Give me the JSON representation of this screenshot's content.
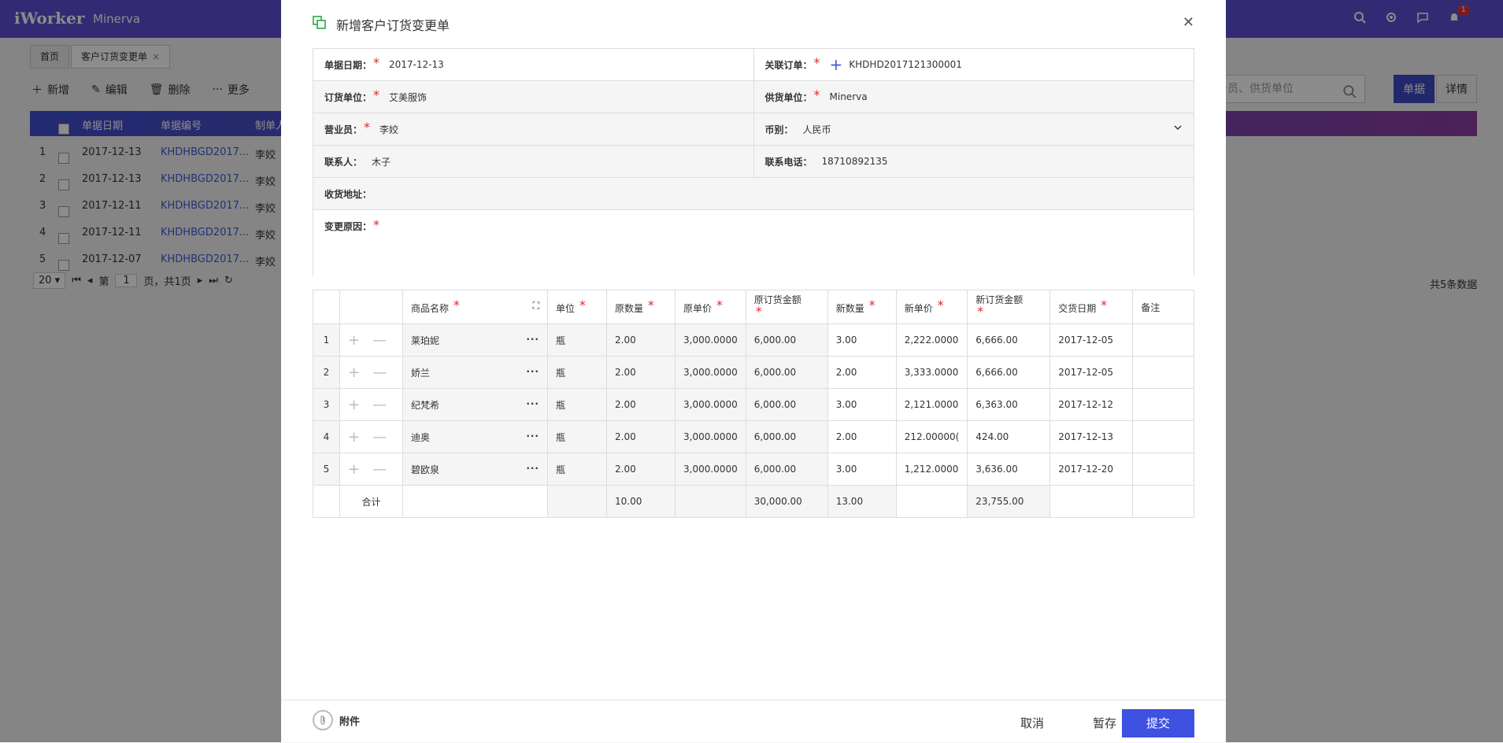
{
  "header": {
    "logo": "iWorker",
    "company": "Minerva",
    "notification_count": "1"
  },
  "tabs": [
    {
      "label": "首页"
    },
    {
      "label": "客户订货变更单"
    }
  ],
  "toolbar": {
    "add": "新增",
    "edit": "编辑",
    "delete": "删除",
    "more": "更多",
    "search_placeholder": "务员、供货单位",
    "view_doc": "单据",
    "view_detail": "详情"
  },
  "grid": {
    "columns": [
      "单据日期",
      "单据编号",
      "制单人"
    ],
    "rows": [
      {
        "idx": "1",
        "date": "2017-12-13",
        "code": "KHDHBGD2017...",
        "maker": "李姣"
      },
      {
        "idx": "2",
        "date": "2017-12-13",
        "code": "KHDHBGD2017...",
        "maker": "李姣"
      },
      {
        "idx": "3",
        "date": "2017-12-11",
        "code": "KHDHBGD2017...",
        "maker": "李姣"
      },
      {
        "idx": "4",
        "date": "2017-12-11",
        "code": "KHDHBGD2017...",
        "maker": "李姣"
      },
      {
        "idx": "5",
        "date": "2017-12-07",
        "code": "KHDHBGD2017...",
        "maker": "李姣"
      }
    ],
    "page_size": "20",
    "page_prefix": "第",
    "page_num": "1",
    "page_suffix": "页，共1页",
    "total": "共5条数据"
  },
  "modal": {
    "title": "新增客户订货变更单",
    "form": {
      "date_label": "单据日期：",
      "date_value": "2017-12-13",
      "order_label": "关联订单：",
      "order_value": "KHDHD2017121300001",
      "customer_label": "订货单位：",
      "customer_value": "艾美服饰",
      "supplier_label": "供货单位：",
      "supplier_value": "Minerva",
      "sales_label": "营业员：",
      "sales_value": "李姣",
      "currency_label": "币别：",
      "currency_value": "人民币",
      "contact_label": "联系人：",
      "contact_value": "木子",
      "phone_label": "联系电话：",
      "phone_value": "18710892135",
      "address_label": "收货地址：",
      "reason_label": "变更原因："
    },
    "table": {
      "headers": [
        "商品名称",
        "单位",
        "原数量",
        "原单价",
        "原订货金额",
        "新数量",
        "新单价",
        "新订货金额",
        "交货日期",
        "备注"
      ],
      "rows": [
        {
          "idx": "1",
          "name": "莱珀妮",
          "unit": "瓶",
          "oq": "2.00",
          "op": "3,000.0000",
          "oa": "6,000.00",
          "nq": "3.00",
          "np": "2,222.0000",
          "na": "6,666.00",
          "dd": "2017-12-05"
        },
        {
          "idx": "2",
          "name": "娇兰",
          "unit": "瓶",
          "oq": "2.00",
          "op": "3,000.0000",
          "oa": "6,000.00",
          "nq": "2.00",
          "np": "3,333.0000",
          "na": "6,666.00",
          "dd": "2017-12-05"
        },
        {
          "idx": "3",
          "name": "纪梵希",
          "unit": "瓶",
          "oq": "2.00",
          "op": "3,000.0000",
          "oa": "6,000.00",
          "nq": "3.00",
          "np": "2,121.0000",
          "na": "6,363.00",
          "dd": "2017-12-12"
        },
        {
          "idx": "4",
          "name": "迪奥",
          "unit": "瓶",
          "oq": "2.00",
          "op": "3,000.0000",
          "oa": "6,000.00",
          "nq": "2.00",
          "np": "212.00000(",
          "na": "424.00",
          "dd": "2017-12-13"
        },
        {
          "idx": "5",
          "name": "碧欧泉",
          "unit": "瓶",
          "oq": "2.00",
          "op": "3,000.0000",
          "oa": "6,000.00",
          "nq": "3.00",
          "np": "1,212.0000",
          "na": "3,636.00",
          "dd": "2017-12-20"
        }
      ],
      "total_label": "合计",
      "total_oq": "10.00",
      "total_oa": "30,000.00",
      "total_nq": "13.00",
      "total_na": "23,755.00"
    },
    "footer": {
      "attach": "附件",
      "cancel": "取消",
      "save_draft": "暂存",
      "submit": "提交"
    }
  }
}
